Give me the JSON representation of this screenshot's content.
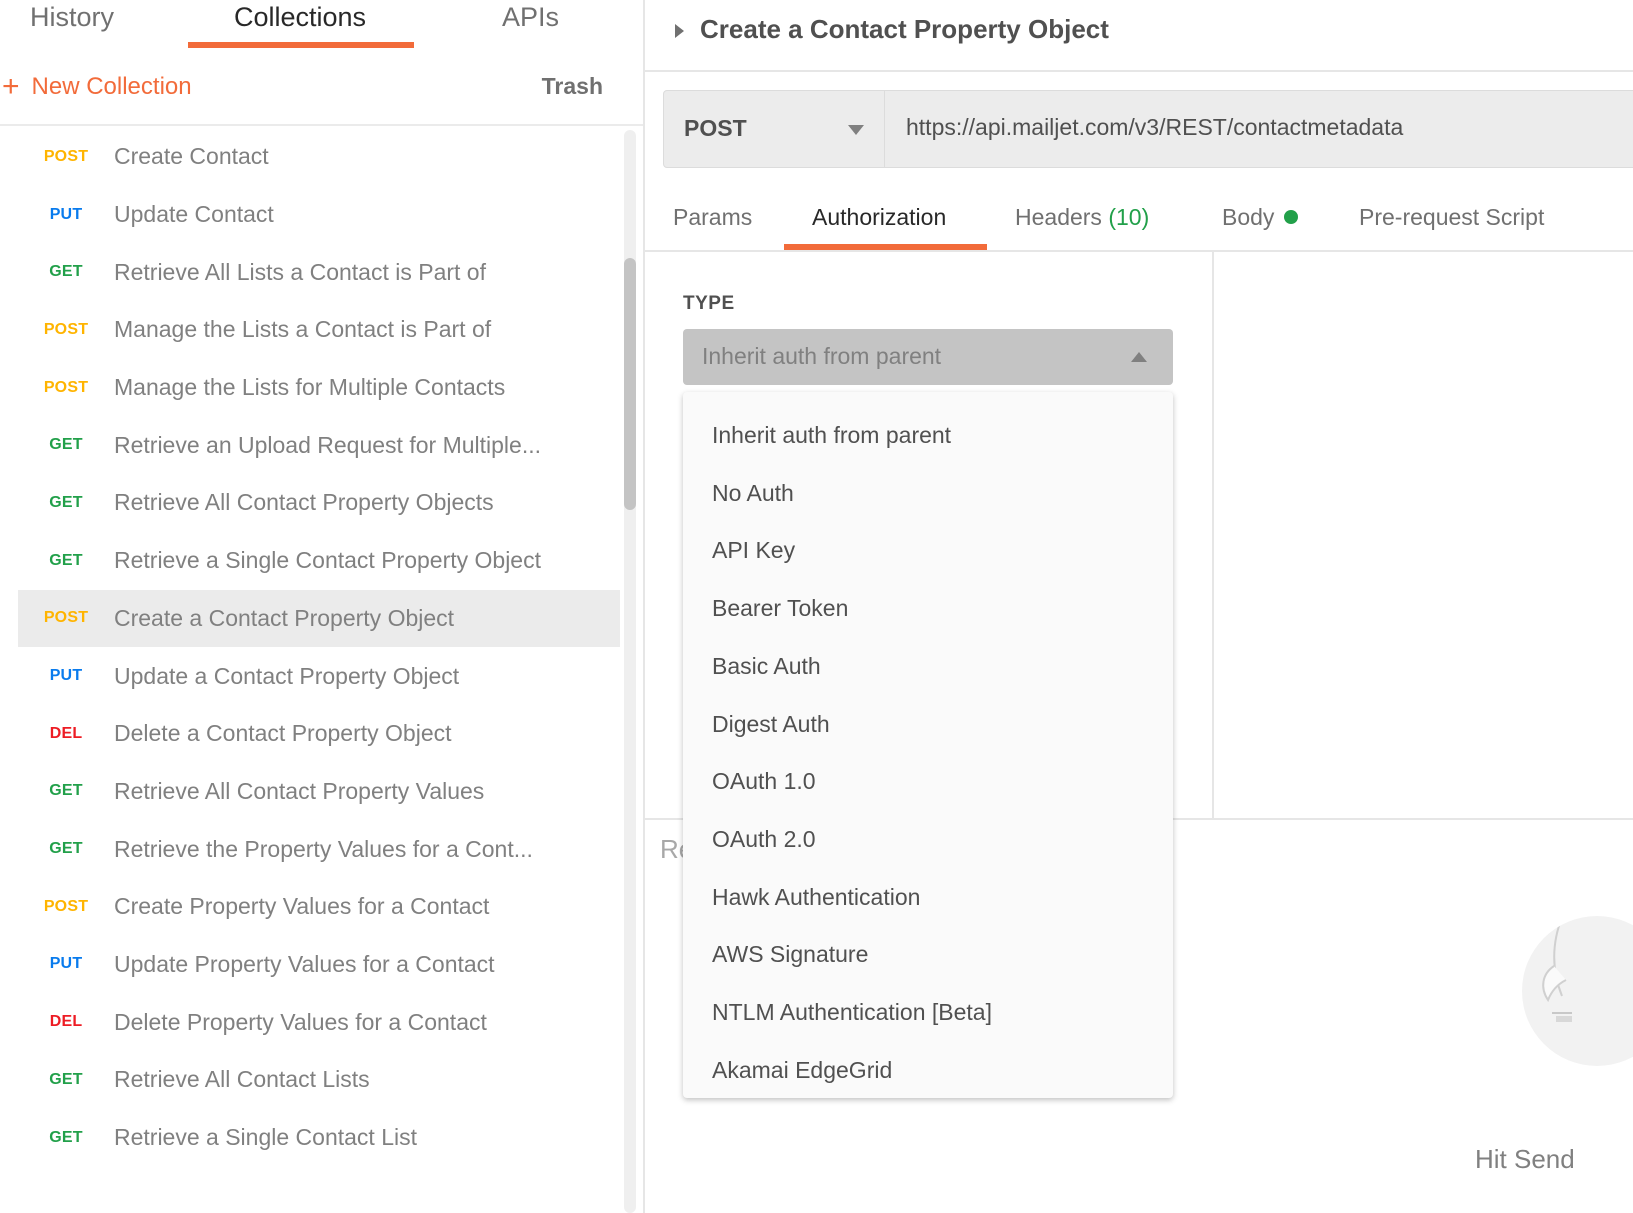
{
  "sidebar": {
    "tabs": [
      {
        "label": "History",
        "active": false
      },
      {
        "label": "Collections",
        "active": true
      },
      {
        "label": "APIs",
        "active": false
      }
    ],
    "new_collection_label": "New Collection",
    "trash_label": "Trash",
    "requests": [
      {
        "method": "POST",
        "name": "Create Contact"
      },
      {
        "method": "PUT",
        "name": "Update Contact"
      },
      {
        "method": "GET",
        "name": "Retrieve All Lists a Contact is Part of"
      },
      {
        "method": "POST",
        "name": "Manage the Lists a Contact is Part of"
      },
      {
        "method": "POST",
        "name": "Manage the Lists for Multiple Contacts"
      },
      {
        "method": "GET",
        "name": "Retrieve an Upload Request for Multiple..."
      },
      {
        "method": "GET",
        "name": "Retrieve All Contact Property Objects"
      },
      {
        "method": "GET",
        "name": "Retrieve a Single Contact Property Object"
      },
      {
        "method": "POST",
        "name": "Create a Contact Property Object",
        "selected": true
      },
      {
        "method": "PUT",
        "name": "Update a Contact Property Object"
      },
      {
        "method": "DEL",
        "name": "Delete a Contact Property Object"
      },
      {
        "method": "GET",
        "name": "Retrieve All Contact Property Values"
      },
      {
        "method": "GET",
        "name": "Retrieve the Property Values for a Cont..."
      },
      {
        "method": "POST",
        "name": "Create Property Values for a Contact"
      },
      {
        "method": "PUT",
        "name": "Update Property Values for a Contact"
      },
      {
        "method": "DEL",
        "name": "Delete Property Values for a Contact"
      },
      {
        "method": "GET",
        "name": "Retrieve All Contact Lists"
      },
      {
        "method": "GET",
        "name": "Retrieve a Single Contact List"
      }
    ]
  },
  "request": {
    "title": "Create a Contact Property Object",
    "method": "POST",
    "url": "https://api.mailjet.com/v3/REST/contactmetadata",
    "tabs": {
      "params": "Params",
      "authorization": "Authorization",
      "headers": "Headers",
      "headers_count": "(10)",
      "body": "Body",
      "prerequest": "Pre-request Script"
    },
    "active_tab": "Authorization"
  },
  "auth": {
    "type_label": "TYPE",
    "selected": "Inherit auth from parent",
    "options": [
      "Inherit auth from parent",
      "No Auth",
      "API Key",
      "Bearer Token",
      "Basic Auth",
      "Digest Auth",
      "OAuth 1.0",
      "OAuth 2.0",
      "Hawk Authentication",
      "AWS Signature",
      "NTLM Authentication [Beta]",
      "Akamai EdgeGrid"
    ]
  },
  "response": {
    "label_partial": "Re",
    "hint_partial": "Hit Send"
  },
  "colors": {
    "accent": "#f26b3a",
    "post": "#ffb400",
    "put": "#097bed",
    "get": "#22a04a",
    "del": "#ed1c24"
  }
}
